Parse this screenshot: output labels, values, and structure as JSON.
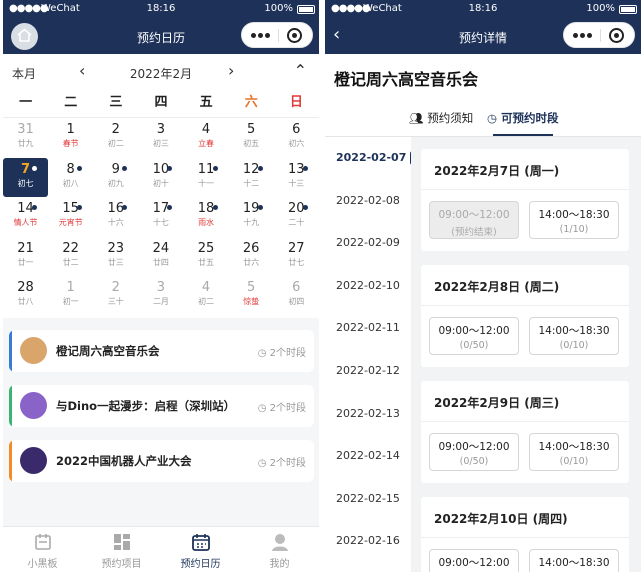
{
  "left": {
    "status": {
      "carrier": "WeChat",
      "time": "18:16",
      "battery": "100%"
    },
    "nav_title": "预约日历",
    "calendar": {
      "mode": "本月",
      "month": "2022年2月",
      "weekdays": [
        "一",
        "二",
        "三",
        "四",
        "五",
        "六",
        "日"
      ],
      "days": [
        {
          "n": "31",
          "s": "廿九",
          "other": true
        },
        {
          "n": "1",
          "s": "春节",
          "red": true
        },
        {
          "n": "2",
          "s": "初二"
        },
        {
          "n": "3",
          "s": "初三"
        },
        {
          "n": "4",
          "s": "立春",
          "red": true
        },
        {
          "n": "5",
          "s": "初五"
        },
        {
          "n": "6",
          "s": "初六"
        },
        {
          "n": "7",
          "s": "初七",
          "sel": true,
          "dot": true
        },
        {
          "n": "8",
          "s": "初八",
          "dot": true
        },
        {
          "n": "9",
          "s": "初九",
          "dot": true
        },
        {
          "n": "10",
          "s": "初十",
          "dot": true
        },
        {
          "n": "11",
          "s": "十一",
          "dot": true
        },
        {
          "n": "12",
          "s": "十二",
          "dot": true
        },
        {
          "n": "13",
          "s": "十三",
          "dot": true
        },
        {
          "n": "14",
          "s": "情人节",
          "red": true,
          "dot": true
        },
        {
          "n": "15",
          "s": "元宵节",
          "red": true,
          "dot": true
        },
        {
          "n": "16",
          "s": "十六",
          "dot": true
        },
        {
          "n": "17",
          "s": "十七",
          "dot": true
        },
        {
          "n": "18",
          "s": "雨水",
          "red": true,
          "dot": true
        },
        {
          "n": "19",
          "s": "十九",
          "dot": true
        },
        {
          "n": "20",
          "s": "二十",
          "dot": true
        },
        {
          "n": "21",
          "s": "廿一"
        },
        {
          "n": "22",
          "s": "廿二"
        },
        {
          "n": "23",
          "s": "廿三"
        },
        {
          "n": "24",
          "s": "廿四"
        },
        {
          "n": "25",
          "s": "廿五"
        },
        {
          "n": "26",
          "s": "廿六"
        },
        {
          "n": "27",
          "s": "廿七"
        },
        {
          "n": "28",
          "s": "廿八"
        },
        {
          "n": "1",
          "s": "初一",
          "other": true
        },
        {
          "n": "2",
          "s": "三十",
          "other": true
        },
        {
          "n": "3",
          "s": "二月",
          "other": true
        },
        {
          "n": "4",
          "s": "初二",
          "other": true
        },
        {
          "n": "5",
          "s": "惊蛰",
          "other": true,
          "red": true
        },
        {
          "n": "6",
          "s": "初四",
          "other": true
        }
      ]
    },
    "events": [
      {
        "name": "橙记周六高空音乐会",
        "slots": "2个时段",
        "bar_color": "#3a7bd5",
        "thumb_color": "#d9a56a"
      },
      {
        "name": "与Dino一起漫步：启程（深圳站）",
        "slots": "2个时段",
        "bar_color": "#3cb371",
        "thumb_color": "#8a63c9"
      },
      {
        "name": "2022中国机器人产业大会",
        "slots": "2个时段",
        "bar_color": "#f28c28",
        "thumb_color": "#3a2a6b"
      }
    ],
    "tabbar": [
      {
        "label": "小黑板",
        "icon": "board-icon"
      },
      {
        "label": "预约项目",
        "icon": "grid-icon"
      },
      {
        "label": "预约日历",
        "icon": "calendar-icon",
        "active": true
      },
      {
        "label": "我的",
        "icon": "profile-icon"
      }
    ]
  },
  "right": {
    "status": {
      "carrier": "WeChat",
      "time": "18:16",
      "battery": "100%"
    },
    "nav_title": "预约详情",
    "event_title": "橙记周六高空音乐会",
    "tabs": [
      {
        "label": "预约须知",
        "icon": "people-icon"
      },
      {
        "label": "可预约时段",
        "icon": "clock-check-icon",
        "active": true
      }
    ],
    "dates": [
      "2022-02-07",
      "2022-02-08",
      "2022-02-09",
      "2022-02-10",
      "2022-02-11",
      "2022-02-12",
      "2022-02-13",
      "2022-02-14",
      "2022-02-15",
      "2022-02-16"
    ],
    "day_cards": [
      {
        "title": "2022年2月7日 (周一)",
        "slots": [
          {
            "time": "09:00～12:00",
            "cap": "(预约结束)",
            "ended": true
          },
          {
            "time": "14:00～18:30",
            "cap": "(1/10)"
          }
        ]
      },
      {
        "title": "2022年2月8日 (周二)",
        "slots": [
          {
            "time": "09:00～12:00",
            "cap": "(0/50)"
          },
          {
            "time": "14:00～18:30",
            "cap": "(0/10)"
          }
        ]
      },
      {
        "title": "2022年2月9日 (周三)",
        "slots": [
          {
            "time": "09:00～12:00",
            "cap": "(0/50)"
          },
          {
            "time": "14:00～18:30",
            "cap": "(0/10)"
          }
        ]
      },
      {
        "title": "2022年2月10日 (周四)",
        "slots": [
          {
            "time": "09:00～12:00",
            "cap": ""
          },
          {
            "time": "14:00～18:30",
            "cap": ""
          }
        ]
      }
    ]
  }
}
